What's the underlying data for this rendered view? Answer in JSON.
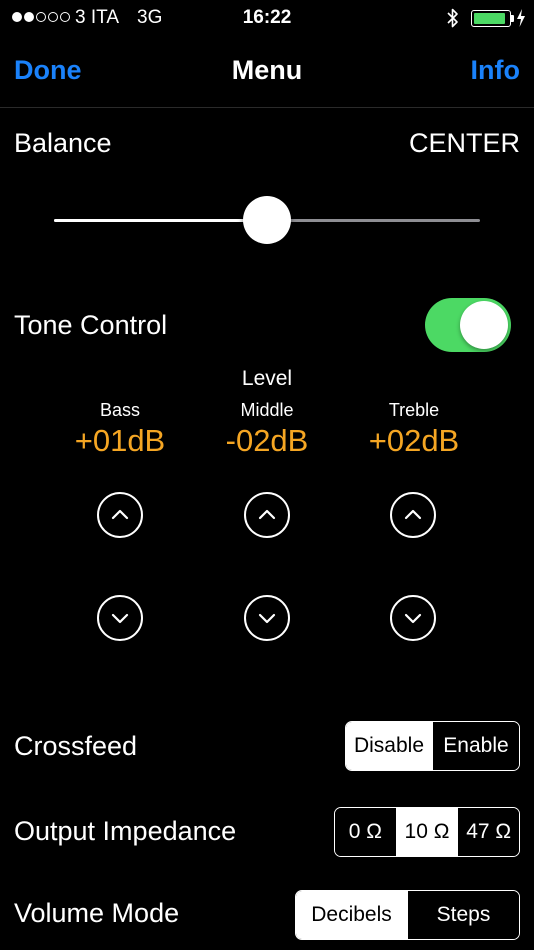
{
  "status_bar": {
    "signal_filled": 2,
    "signal_total": 5,
    "carrier": "3 ITA",
    "network": "3G",
    "time": "16:22",
    "battery_level": 0.92,
    "battery_color": "#4cd964"
  },
  "nav": {
    "left_label": "Done",
    "title": "Menu",
    "right_label": "Info",
    "accent_color": "#1a82fb"
  },
  "balance": {
    "label": "Balance",
    "value": "CENTER",
    "position": 0.5
  },
  "tone_control": {
    "label": "Tone Control",
    "enabled": true
  },
  "level": {
    "title": "Level",
    "value_color": "#f5a623",
    "bands": [
      {
        "name": "Bass",
        "value": "+01dB",
        "up_icon": "chevron-up-icon",
        "down_icon": "chevron-down-icon"
      },
      {
        "name": "Middle",
        "value": "-02dB",
        "up_icon": "chevron-up-icon",
        "down_icon": "chevron-down-icon"
      },
      {
        "name": "Treble",
        "value": "+02dB",
        "up_icon": "chevron-up-icon",
        "down_icon": "chevron-down-icon"
      }
    ]
  },
  "crossfeed": {
    "label": "Crossfeed",
    "options": [
      "Disable",
      "Enable"
    ],
    "selected": 0
  },
  "output_impedance": {
    "label": "Output Impedance",
    "options": [
      "0 Ω",
      "10 Ω",
      "47 Ω"
    ],
    "selected": 1
  },
  "volume_mode": {
    "label": "Volume Mode",
    "options": [
      "Decibels",
      "Steps"
    ],
    "selected": 0
  }
}
